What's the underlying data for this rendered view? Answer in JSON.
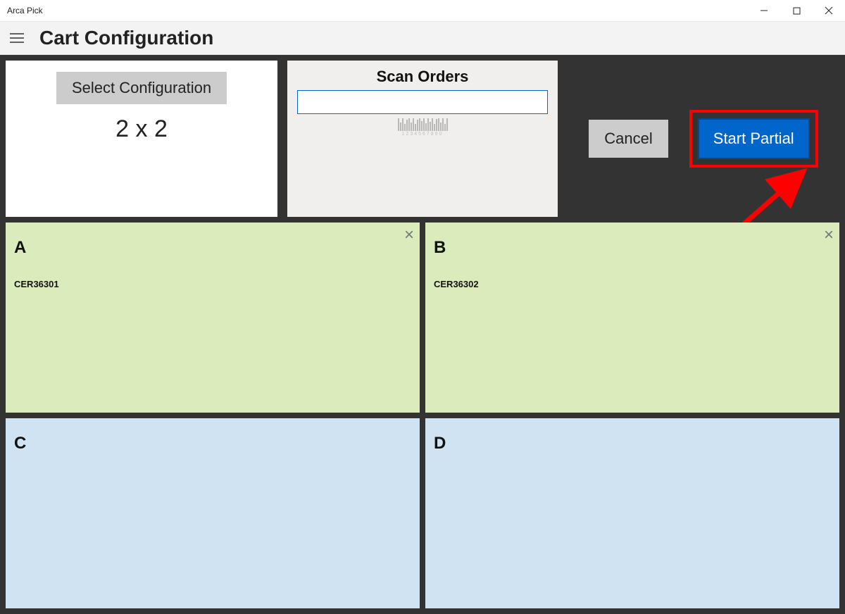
{
  "window": {
    "title": "Arca Pick"
  },
  "header": {
    "title": "Cart Configuration"
  },
  "config_panel": {
    "select_button": "Select Configuration",
    "config_text": "2 x 2"
  },
  "scan_panel": {
    "title": "Scan Orders",
    "input_value": "",
    "barcode_number": "1234567890"
  },
  "actions": {
    "cancel": "Cancel",
    "start_partial": "Start Partial"
  },
  "slots": [
    {
      "label": "A",
      "order": "CER36301",
      "filled": true
    },
    {
      "label": "B",
      "order": "CER36302",
      "filled": true
    },
    {
      "label": "C",
      "order": "",
      "filled": false
    },
    {
      "label": "D",
      "order": "",
      "filled": false
    }
  ]
}
